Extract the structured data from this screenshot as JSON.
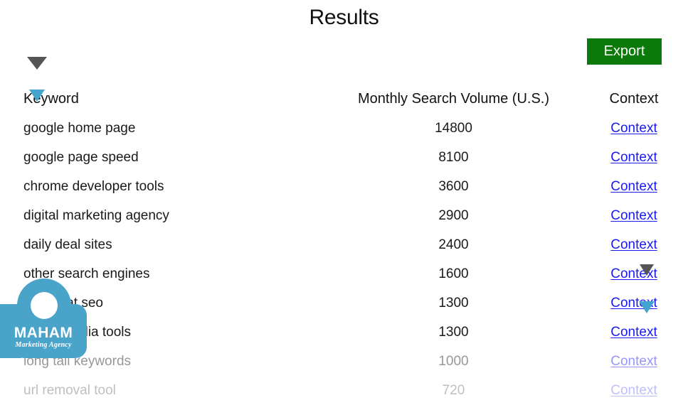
{
  "header": {
    "title": "Results"
  },
  "toolbar": {
    "export_label": "Export",
    "export_bg": "#0b7a0b",
    "export_fg": "#ffffff",
    "sort_caret_icon": "triangle-down-icon",
    "sort_caret_color": "#555555"
  },
  "table": {
    "columns": [
      {
        "key": "keyword",
        "label": "Keyword"
      },
      {
        "key": "volume",
        "label": "Monthly Search Volume (U.S.)"
      },
      {
        "key": "context",
        "label": "Context"
      }
    ],
    "link_label": "Context",
    "link_color": "#1a1aee",
    "rows": [
      {
        "keyword": "google home page",
        "volume": "14800",
        "context": "Context"
      },
      {
        "keyword": "google page speed",
        "volume": "8100",
        "context": "Context"
      },
      {
        "keyword": "chrome developer tools",
        "volume": "3600",
        "context": "Context"
      },
      {
        "keyword": "digital marketing agency",
        "volume": "2900",
        "context": "Context"
      },
      {
        "keyword": "daily deal sites",
        "volume": "2400",
        "context": "Context"
      },
      {
        "keyword": "other search engines",
        "volume": "1600",
        "context": "Context"
      },
      {
        "keyword": "white hat seo",
        "volume": "1300",
        "context": "Context"
      },
      {
        "keyword": "social media tools",
        "volume": "1300",
        "context": "Context"
      },
      {
        "keyword": "long tail keywords",
        "volume": "1000",
        "context": "Context"
      },
      {
        "keyword": "url removal tool",
        "volume": "720",
        "context": "Context"
      }
    ]
  },
  "cursors": [
    {
      "name": "pointer-keyword",
      "icon": "triangle-down-icon",
      "color": "#45a5ce"
    },
    {
      "name": "pointer-context-row6",
      "icon": "triangle-down-icon",
      "color": "#555555"
    },
    {
      "name": "pointer-context-row7",
      "icon": "triangle-down-icon",
      "color": "#45a5ce"
    }
  ],
  "watermark": {
    "name": "MAHAM",
    "tagline": "Marketing Agency",
    "color": "#4aa3c9"
  }
}
